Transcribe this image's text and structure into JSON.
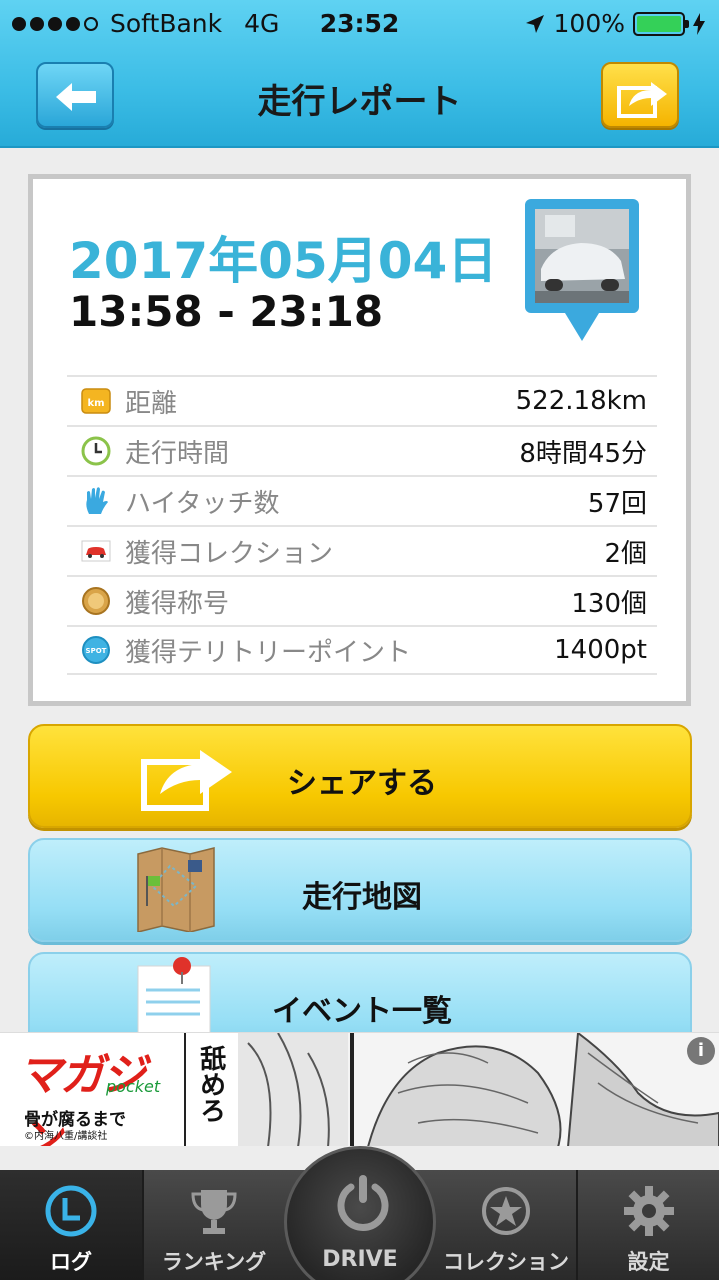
{
  "status_bar": {
    "carrier": "SoftBank",
    "network": "4G",
    "time": "23:52",
    "battery": "100%",
    "signal_bars": 4,
    "battery_level": 1.0,
    "battery_color": "#34d058"
  },
  "nav": {
    "title": "走行レポート",
    "back_icon": "arrow-left-icon",
    "share_icon": "share-arrow-icon"
  },
  "report": {
    "date": "2017年05月04日",
    "time_range": "13:58 - 23:18",
    "photo_icon": "car-photo-pin-icon",
    "stats": [
      {
        "icon": "km-icon",
        "label": "距離",
        "value": "522.18km",
        "icon_text": "km"
      },
      {
        "icon": "clock-icon",
        "label": "走行時間",
        "value": "8時間45分"
      },
      {
        "icon": "high-touch-hand-icon",
        "label": "ハイタッチ数",
        "value": "57回"
      },
      {
        "icon": "car-card-icon",
        "label": "獲得コレクション",
        "value": "2個"
      },
      {
        "icon": "medal-icon",
        "label": "獲得称号",
        "value": "130個"
      },
      {
        "icon": "spot-icon",
        "label": "獲得テリトリーポイント",
        "value": "1400pt",
        "icon_text": "SPOT"
      }
    ]
  },
  "buttons": {
    "share": "シェアする",
    "map": "走行地図",
    "events": "イベント一覧"
  },
  "ad": {
    "logo": "マガジン",
    "logo_sub": "pocket",
    "title": "骨が腐るまで",
    "credit": "©内海八重/講談社",
    "vertical_text": "舐めろ",
    "info": "i"
  },
  "tabs": [
    {
      "label": "ログ",
      "icon": "log-clock-icon",
      "active": true
    },
    {
      "label": "ランキング",
      "icon": "trophy-icon",
      "active": false
    },
    {
      "label": "DRIVE",
      "icon": "power-icon",
      "active": false
    },
    {
      "label": "コレクション",
      "icon": "star-icon",
      "active": false
    },
    {
      "label": "設定",
      "icon": "gear-icon",
      "active": false
    }
  ],
  "colors": {
    "accent": "#3ab3d8",
    "header": "#3cbde6",
    "share_button": "#f7c800",
    "map_button": "#95def5",
    "tabbar": "#2a2a2a"
  }
}
